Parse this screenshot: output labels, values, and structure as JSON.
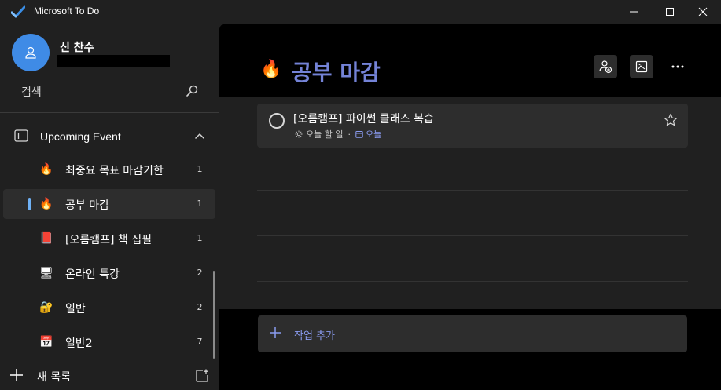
{
  "window": {
    "title": "Microsoft To Do",
    "logo_icon": "checkmark-logo-icon",
    "minimize_icon": "minimize-icon",
    "maximize_icon": "maximize-icon",
    "close_icon": "close-icon"
  },
  "colors": {
    "accent": "#7483d7",
    "accent_light": "#8a9bf0",
    "avatar_bg": "#3f8be6",
    "sidebar_bg": "#202020",
    "card_bg": "#2d2d2d"
  },
  "user": {
    "name": "신 찬수",
    "avatar_icon": "person-icon"
  },
  "search": {
    "label": "검색",
    "icon": "search-icon"
  },
  "sidebar": {
    "group": {
      "label": "Upcoming Event",
      "icon": "group-icon",
      "expanded": true
    },
    "items": [
      {
        "icon": "🔥",
        "label": "최중요 목표 마감기한",
        "count": "1",
        "active": false
      },
      {
        "icon": "🔥",
        "label": "공부 마감",
        "count": "1",
        "active": true
      },
      {
        "icon": "📕",
        "label": "[오름캠프] 책 집필",
        "count": "1",
        "active": false
      },
      {
        "icon": "🖥",
        "label": "온라인 특강",
        "count": "2",
        "active": false
      },
      {
        "icon": "🔐",
        "label": "일반",
        "count": "2",
        "active": false
      },
      {
        "icon": "📅",
        "label": "일반2",
        "count": "7",
        "active": false
      }
    ],
    "new_list": {
      "label": "새 목록",
      "plus_icon": "plus-icon",
      "new_group_icon": "new-group-icon"
    }
  },
  "main": {
    "list_emoji": "🔥",
    "list_title": "공부 마감",
    "header_buttons": [
      "share-list-icon",
      "change-theme-icon",
      "more-options-icon"
    ],
    "tasks": [
      {
        "title": "[오름캠프] 파이썬 클래스 복습",
        "my_day_label": "오늘 할 일",
        "separator": "·",
        "due_label": "오늘",
        "completed": false,
        "starred": false
      }
    ],
    "add_task": {
      "label": "작업 추가",
      "icon": "plus-icon"
    }
  }
}
